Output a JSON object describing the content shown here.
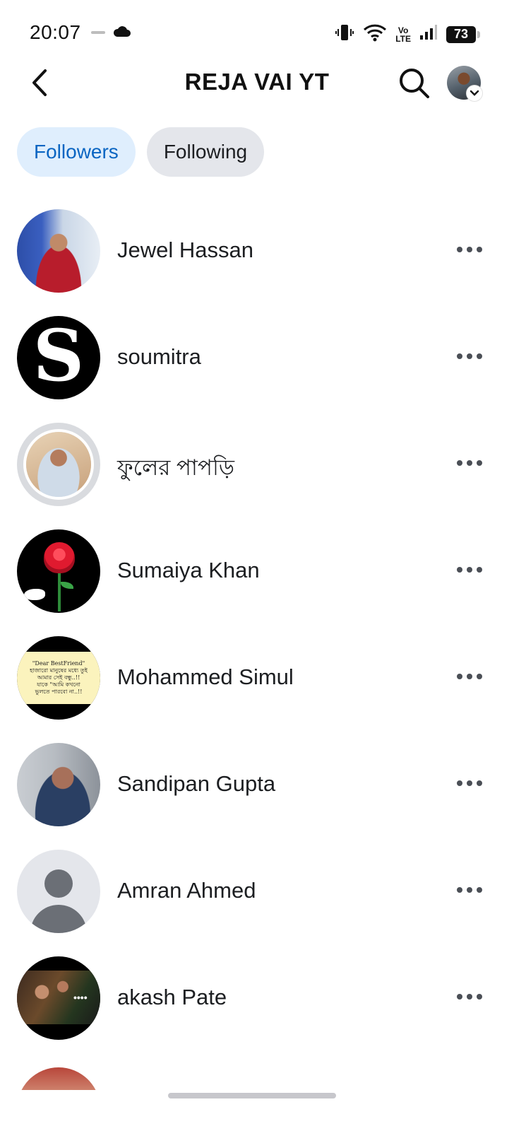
{
  "status_bar": {
    "time": "20:07",
    "volte_top": "Vo",
    "volte_bottom": "LTE",
    "battery": "73"
  },
  "header": {
    "title": "REJA VAI YT"
  },
  "tabs": [
    {
      "label": "Followers",
      "active": true
    },
    {
      "label": "Following",
      "active": false
    }
  ],
  "followers": [
    {
      "name": "Jewel Hassan"
    },
    {
      "name": "soumitra"
    },
    {
      "name": "ফুলের পাপড়ি"
    },
    {
      "name": "Sumaiya Khan"
    },
    {
      "name": "Mohammed Simul"
    },
    {
      "name": "Sandipan Gupta"
    },
    {
      "name": "Amran Ahmed"
    },
    {
      "name": "akash Pate"
    }
  ],
  "avatar_texts": {
    "soumitra_letter": "S",
    "simul_card": [
      "\"Dear BestFriend\"",
      "হাজারো মানুষের মধ্যে তুই",
      "আমার সেই বন্ধু..!!",
      "যাকে \"আমি কখনো",
      "ভুলতে পারবো না..!!"
    ],
    "akash_overlay": "••••"
  },
  "colors": {
    "accent": "#0a65c2",
    "active_tab_bg": "#dfeefd",
    "inactive_tab_bg": "#e4e6eb"
  }
}
